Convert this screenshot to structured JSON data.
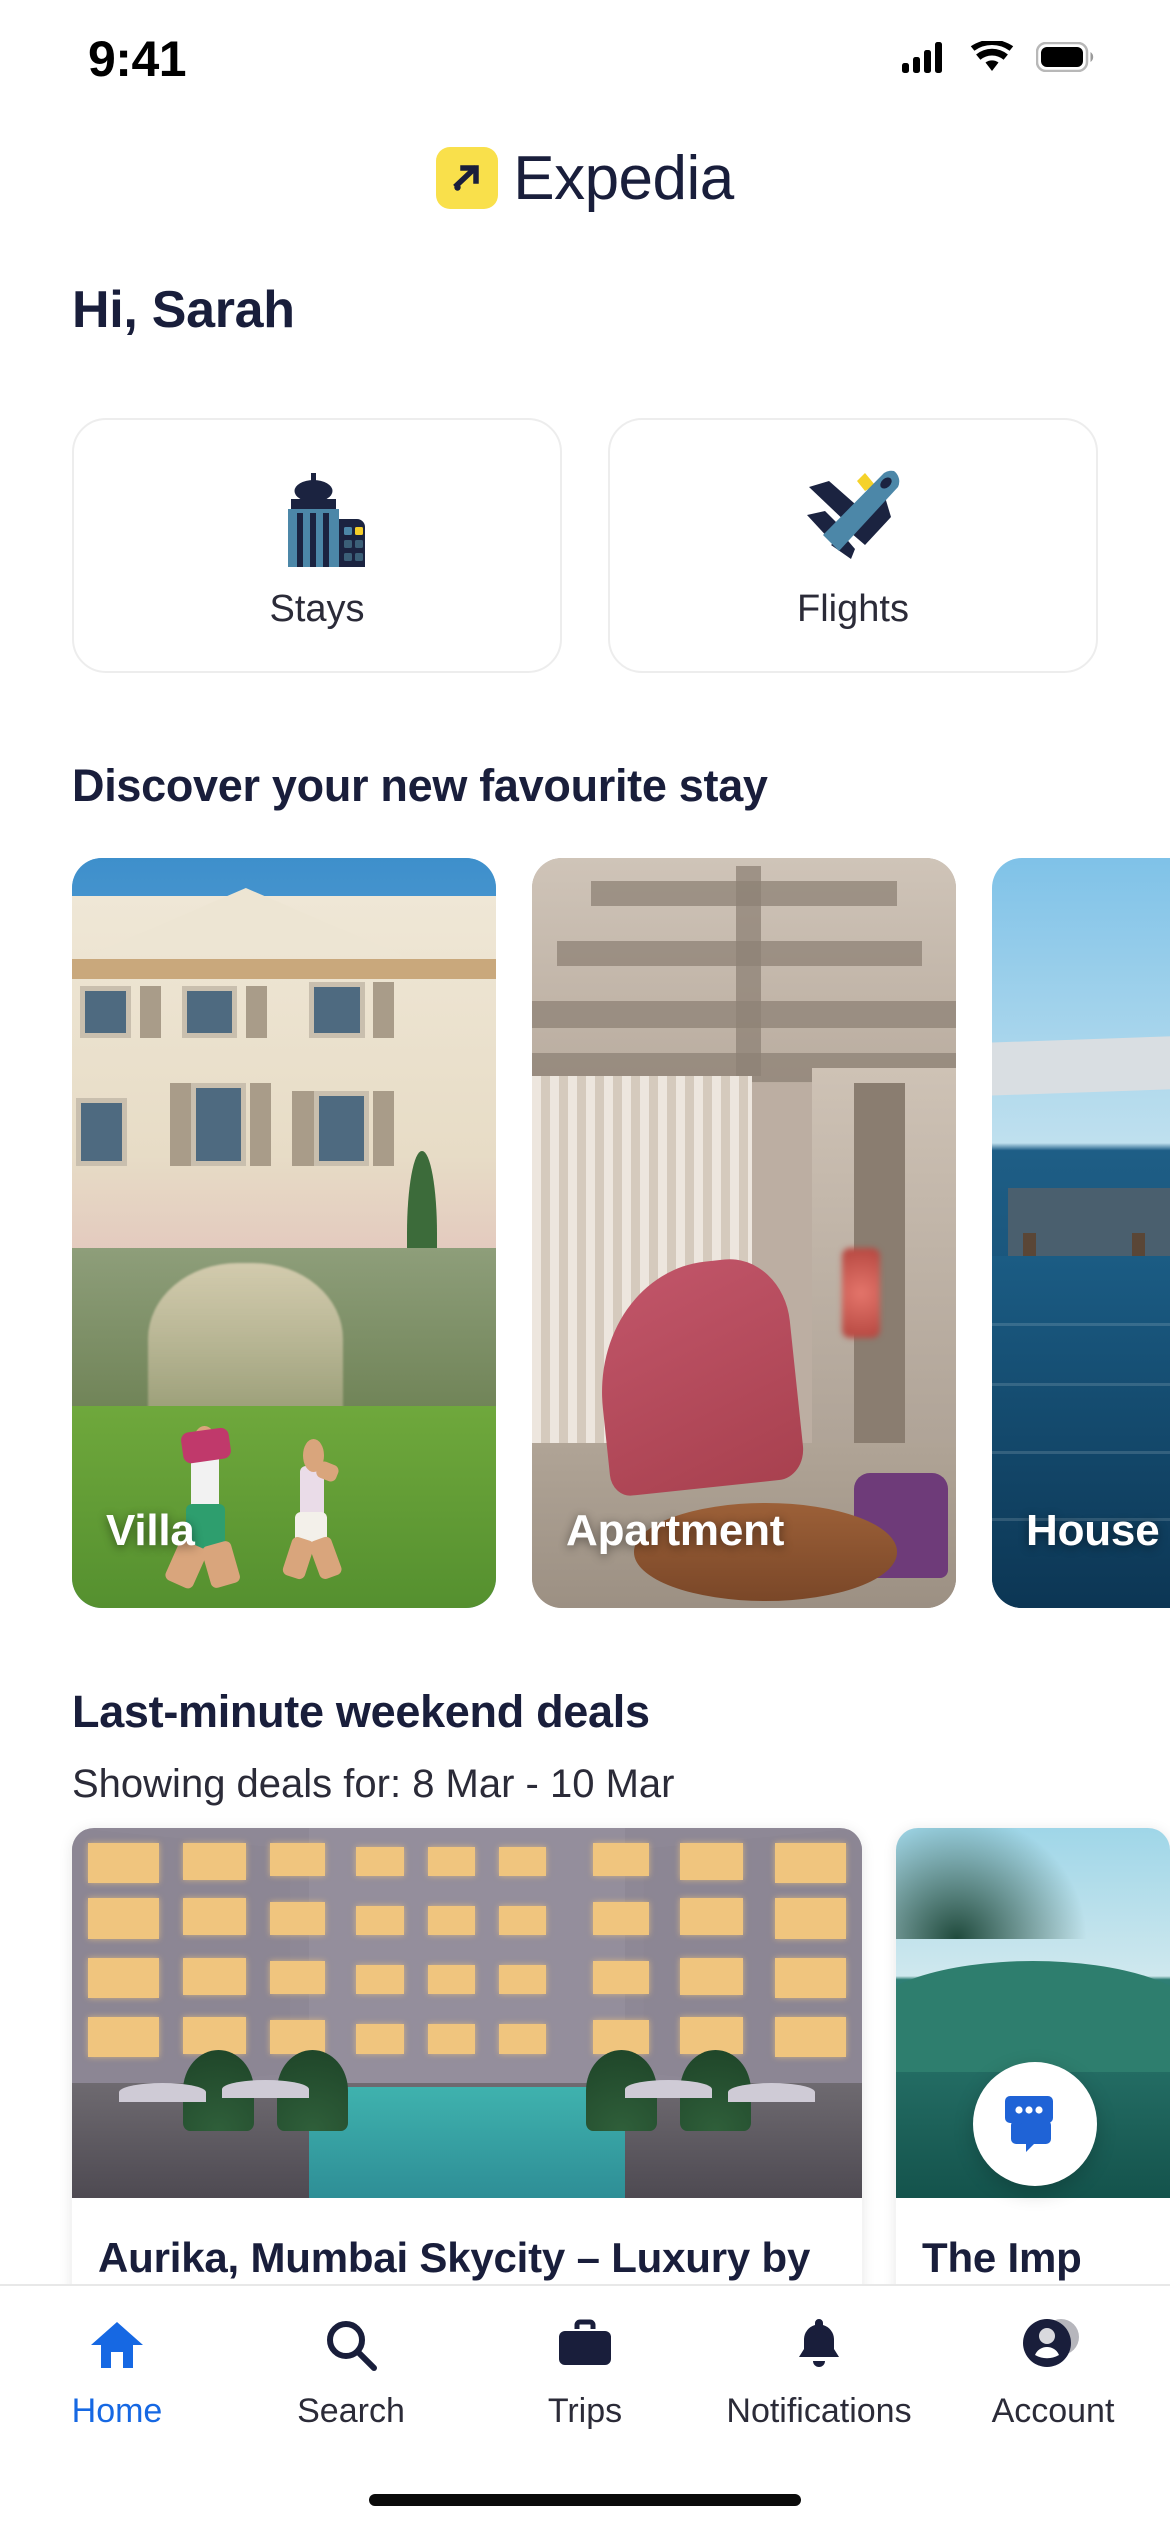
{
  "status_bar": {
    "time": "9:41",
    "cellular_icon": "cellular-signal-icon",
    "wifi_icon": "wifi-icon",
    "battery_icon": "battery-full-icon"
  },
  "brand": {
    "logo_icon": "expedia-arrow-logo-icon",
    "name": "Expedia",
    "badge_color": "#F9E04B",
    "text_color": "#191E3B"
  },
  "greeting": "Hi, Sarah",
  "quick_tiles": [
    {
      "label": "Stays",
      "icon": "building-icon"
    },
    {
      "label": "Flights",
      "icon": "airplane-icon"
    }
  ],
  "discover": {
    "title": "Discover your new favourite stay",
    "cards": [
      {
        "label": "Villa"
      },
      {
        "label": "Apartment"
      },
      {
        "label": "House"
      }
    ]
  },
  "deals": {
    "title": "Last-minute weekend deals",
    "subtitle": "Showing deals for: 8 Mar - 10 Mar",
    "items": [
      {
        "name": "Aurika, Mumbai Skycity – Luxury by"
      },
      {
        "name": "The Imp"
      }
    ]
  },
  "chat_button": {
    "icon": "chat-bubbles-icon",
    "color": "#1F63D6"
  },
  "bottom_nav": {
    "active_color": "#1668E3",
    "inactive_color": "#2B2B38",
    "items": [
      {
        "label": "Home",
        "icon": "home-icon",
        "active": true
      },
      {
        "label": "Search",
        "icon": "search-icon",
        "active": false
      },
      {
        "label": "Trips",
        "icon": "briefcase-icon",
        "active": false
      },
      {
        "label": "Notifications",
        "icon": "bell-icon",
        "active": false
      },
      {
        "label": "Account",
        "icon": "account-avatar-icon",
        "active": false
      }
    ]
  }
}
